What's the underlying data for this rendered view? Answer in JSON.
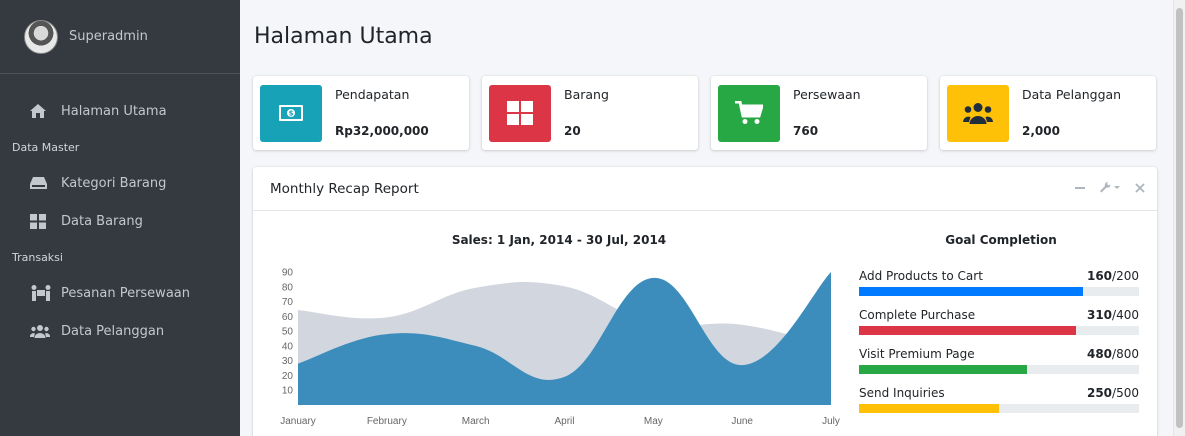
{
  "sidebar": {
    "user_name": "Superadmin",
    "items": [
      {
        "type": "item",
        "label": "Halaman Utama",
        "icon": "home-icon"
      },
      {
        "type": "header",
        "label": "Data Master"
      },
      {
        "type": "item",
        "label": "Kategori Barang",
        "icon": "hdd-icon"
      },
      {
        "type": "item",
        "label": "Data Barang",
        "icon": "th-large-icon"
      },
      {
        "type": "header",
        "label": "Transaksi"
      },
      {
        "type": "item",
        "label": "Pesanan Persewaan",
        "icon": "people-carry-icon"
      },
      {
        "type": "item",
        "label": "Data Pelanggan",
        "icon": "users-icon"
      }
    ]
  },
  "page": {
    "title": "Halaman Utama"
  },
  "info_boxes": [
    {
      "label": "Pendapatan",
      "value": "Rp32,000,000",
      "icon": "money-icon",
      "color": "#17a2b8"
    },
    {
      "label": "Barang",
      "value": "20",
      "icon": "th-large-icon",
      "color": "#dc3545"
    },
    {
      "label": "Persewaan",
      "value": "760",
      "icon": "cart-icon",
      "color": "#28a745"
    },
    {
      "label": "Data Pelanggan",
      "value": "2,000",
      "icon": "users-icon",
      "color": "#ffc107"
    }
  ],
  "report": {
    "title": "Monthly Recap Report",
    "tools": [
      "minus-icon",
      "wrench-icon",
      "close-icon"
    ]
  },
  "chart_data": {
    "type": "area",
    "title": "Sales: 1 Jan, 2014 - 30 Jul, 2014",
    "categories": [
      "January",
      "February",
      "March",
      "April",
      "May",
      "June",
      "July"
    ],
    "yticks": [
      10,
      20,
      30,
      40,
      50,
      60,
      70,
      80,
      90
    ],
    "ylim": [
      0,
      90
    ],
    "series": [
      {
        "values": [
          65,
          60,
          80,
          81,
          56,
          55,
          40
        ],
        "color": "#d2d6de"
      },
      {
        "values": [
          28,
          48,
          40,
          19,
          86,
          27,
          90
        ],
        "color": "#3c8dbc"
      }
    ]
  },
  "goals": {
    "title": "Goal Completion",
    "items": [
      {
        "label": "Add Products to Cart",
        "value": "160",
        "total": "/200",
        "fraction": 0.8,
        "color": "#007bff"
      },
      {
        "label": "Complete Purchase",
        "value": "310",
        "total": "/400",
        "fraction": 0.775,
        "color": "#dc3545"
      },
      {
        "label": "Visit Premium Page",
        "value": "480",
        "total": "/800",
        "fraction": 0.6,
        "color": "#28a745"
      },
      {
        "label": "Send Inquiries",
        "value": "250",
        "total": "/500",
        "fraction": 0.5,
        "color": "#ffc107"
      }
    ]
  }
}
